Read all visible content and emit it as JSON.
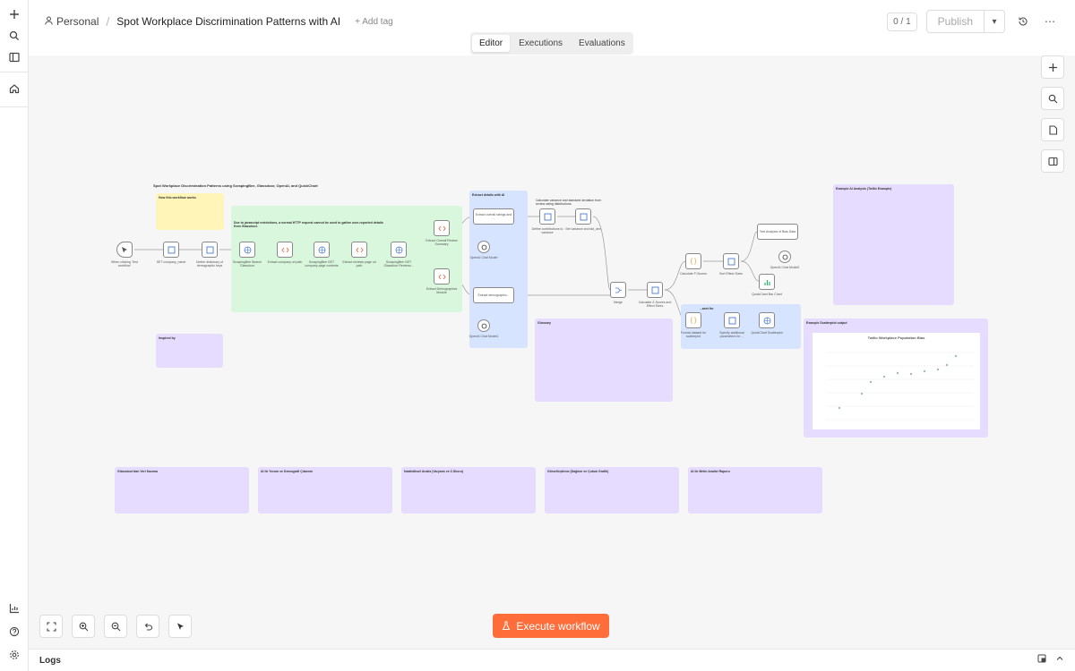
{
  "sidebar": {
    "icons": [
      "plus-icon",
      "search-icon",
      "sidebar-toggle-icon",
      "home-icon",
      "insights-icon",
      "help-icon",
      "settings-icon"
    ]
  },
  "header": {
    "project": "Personal",
    "separator": "/",
    "title": "Spot Workplace Discrimination Patterns with AI",
    "add_tag": "+ Add tag",
    "counter": "0 / 1",
    "publish": "Publish"
  },
  "tabs": [
    {
      "label": "Editor",
      "active": true
    },
    {
      "label": "Executions",
      "active": false
    },
    {
      "label": "Evaluations",
      "active": false
    }
  ],
  "canvas": {
    "main_title": "Spot Workplace Discrimination Patterns using ScrapingBee, Glassdoor, OpenAI, and QuickChart",
    "how_note_title": "How this workflow works",
    "inspired_title": "Inspired by",
    "glossary_title": "Glossary",
    "example_ai_title": "Example AI Analysis (Twilio Example)",
    "scatter_output_title": "Example Scatterplot output",
    "scatter_chart_title": "Twilio Workplace Population Bias",
    "extract_ai_title": "Extract details with AI",
    "scrape_note_title": "Due to javascript restrictions, a normal HTTP request cannot be used to gather user-reported details from Glassdoor.",
    "variance_note_title": "Calculate variance and standard deviation from review rating distributions.",
    "ai_section_title": "...aset for"
  },
  "nodes": [
    {
      "label": "When clicking 'Test workflow'"
    },
    {
      "label": "SET company_name"
    },
    {
      "label": "Define dictionary of demographic keys"
    },
    {
      "label": "ScrapingBee Search Glassdoor"
    },
    {
      "label": "Extract company url path"
    },
    {
      "label": "ScrapingBee GET company page contents"
    },
    {
      "label": "Extract reviews page url path"
    },
    {
      "label": "ScrapingBee GET Glassdoor Reviews..."
    },
    {
      "label": "Extract Overall Review Summary"
    },
    {
      "label": "Extract Demographics Module"
    },
    {
      "label": "Extract overall ratings and ..."
    },
    {
      "label": "Extract demographic..."
    },
    {
      "label": "OpenAI Chat Model"
    },
    {
      "label": "OpenAI Chat Model1"
    },
    {
      "label": "Define contributions to variance"
    },
    {
      "label": "Set variance and std_dev"
    },
    {
      "label": "Merge"
    },
    {
      "label": "Calculate Z-Scores and Effect Sizes"
    },
    {
      "label": "Calculate P-Scores"
    },
    {
      "label": "Sort Effect Sizes"
    },
    {
      "label": "Text Analysis of Bias Data"
    },
    {
      "label": "OpenAI Chat Model2"
    },
    {
      "label": "QuickChart Bar Chart"
    },
    {
      "label": "Format dataset for scatterplot"
    },
    {
      "label": "Specify additional parameters for ..."
    },
    {
      "label": "QuickChart Scatterplot"
    }
  ],
  "bottom_notes": [
    {
      "title": "Glassdoor'dan Veri Kazıma"
    },
    {
      "title": "AI ile Yorum ve Demografi Çıkarımı"
    },
    {
      "title": "İstatistiksel Analiz (Varyans ve Z-Skoru)"
    },
    {
      "title": "Görselleştirme (Dağılım ve Çubuk Grafik)"
    },
    {
      "title": "AI ile Metin Analizi Raporu"
    }
  ],
  "execute_label": "Execute workflow",
  "logs_label": "Logs",
  "colors": {
    "accent": "#ff6d3a",
    "note_yellow": "#fff5b8",
    "note_green": "#d8f7dc",
    "note_blue": "#d6e4ff",
    "note_purple": "#e6dcff"
  }
}
